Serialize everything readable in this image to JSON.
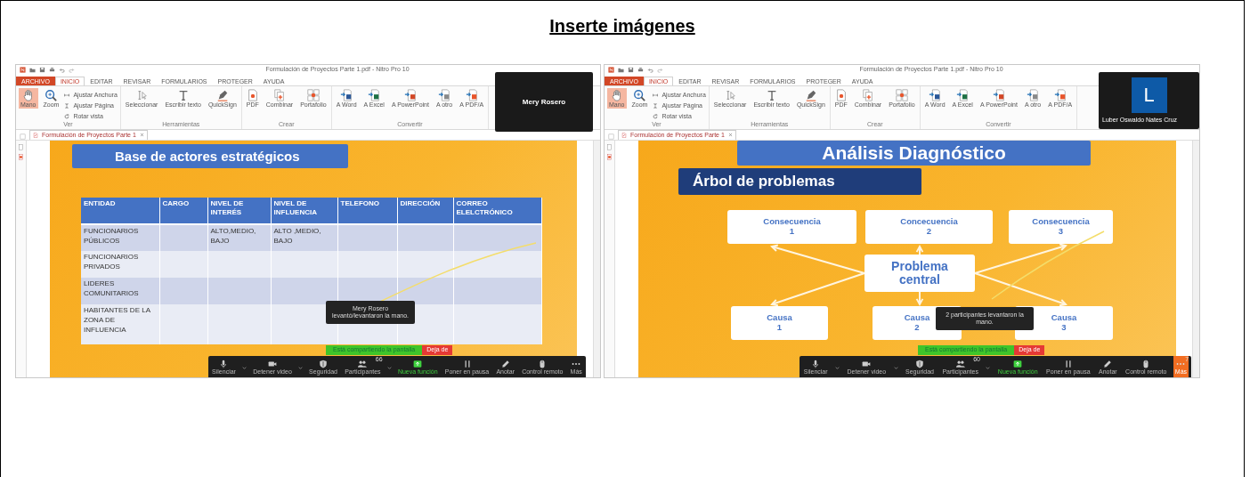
{
  "heading": "Inserte imágenes",
  "screenshots": [
    {
      "window_title": "Formulación de Proyectos Parte 1.pdf - Nitro Pro 10",
      "ribbon_tabs": [
        {
          "label": "ARCHIVO",
          "kind": "file",
          "selected": false
        },
        {
          "label": "INICIO",
          "kind": "tab",
          "selected": true
        },
        {
          "label": "EDITAR",
          "kind": "tab",
          "selected": false
        },
        {
          "label": "REVISAR",
          "kind": "tab",
          "selected": false
        },
        {
          "label": "FORMULARIOS",
          "kind": "tab",
          "selected": false
        },
        {
          "label": "PROTEGER",
          "kind": "tab",
          "selected": false
        },
        {
          "label": "AYUDA",
          "kind": "tab",
          "selected": false
        }
      ],
      "ribbon_groups": [
        {
          "label": "Ver",
          "items": [
            {
              "label": "Mano",
              "kind": "hand",
              "small": false,
              "selected": true
            },
            {
              "label": "Zoom",
              "kind": "zoom",
              "small": false,
              "selected": false
            },
            {
              "label": "Ajustar Anchura",
              "kind": "fitwidth",
              "small": true,
              "selected": false
            },
            {
              "label": "Ajustar Página",
              "kind": "fitpage",
              "small": true,
              "selected": false
            },
            {
              "label": "Rotar vista",
              "kind": "rotate",
              "small": true,
              "selected": false
            }
          ]
        },
        {
          "label": "Herramientas",
          "items": [
            {
              "label": "Seleccionar",
              "kind": "select",
              "small": false,
              "selected": false
            },
            {
              "label": "Escribir texto",
              "kind": "type",
              "small": false,
              "selected": false
            },
            {
              "label": "QuickSign",
              "kind": "sign",
              "small": false,
              "selected": false
            }
          ]
        },
        {
          "label": "Crear",
          "items": [
            {
              "label": "PDF",
              "kind": "pdf",
              "small": false,
              "selected": false
            },
            {
              "label": "Combinar",
              "kind": "combine",
              "small": false,
              "selected": false
            },
            {
              "label": "Portafolio",
              "kind": "portfolio",
              "small": false,
              "selected": false
            }
          ]
        },
        {
          "label": "Convertir",
          "items": [
            {
              "label": "A Word",
              "kind": "word",
              "small": false,
              "selected": false
            },
            {
              "label": "A Excel",
              "kind": "excel",
              "small": false,
              "selected": false
            },
            {
              "label": "A PowerPoint",
              "kind": "ppt",
              "small": false,
              "selected": false
            },
            {
              "label": "A otro",
              "kind": "other",
              "small": false,
              "selected": false
            },
            {
              "label": "A PDF/A",
              "kind": "pdfa",
              "small": false,
              "selected": false
            }
          ]
        }
      ],
      "document_tab": "Formulación de Proyectos Parte 1",
      "video_tile": {
        "name": "Mery Rosero"
      },
      "slide": {
        "kind": "table",
        "title": "Base de actores estratégicos",
        "columns": [
          "ENTIDAD",
          "CARGO",
          "NIVEL DE INTERÉS",
          "NIVEL DE INFLUENCIA",
          "TELEFONO",
          "DIRECCIÓN",
          "CORREO ELELCTRÓNICO"
        ],
        "rows": [
          [
            "FUNCIONARIOS PÚBLICOS",
            null,
            "ALTO,MEDIO, BAJO",
            "ALTO ,MEDIO, BAJO",
            null,
            null,
            null
          ],
          [
            "FUNCIONARIOS PRIVADOS",
            null,
            null,
            null,
            null,
            null,
            null
          ],
          [
            "LIDERES COMUNITARIOS",
            null,
            null,
            null,
            null,
            null,
            null
          ],
          [
            "HABITANTES DE LA ZONA DE INFLUENCIA",
            null,
            null,
            null,
            null,
            null,
            null
          ]
        ]
      },
      "notification": "Mery Rosero levantó/levantaron la mano.",
      "share_bar": {
        "label": "Está compartiendo la pantalla",
        "stop": "Deja de"
      },
      "toolbar": [
        {
          "label": "Silenciar",
          "kind": "mic",
          "has_menu": true,
          "highlighted": false
        },
        {
          "label": "Detener video",
          "kind": "camera",
          "has_menu": true,
          "highlighted": false
        },
        {
          "label": "Seguridad",
          "kind": "shield",
          "has_menu": false,
          "highlighted": false
        },
        {
          "label": "Participantes",
          "kind": "people",
          "badge": "66",
          "has_menu": true,
          "highlighted": false
        },
        {
          "label": "Nueva función",
          "kind": "share",
          "has_menu": false,
          "highlighted": false
        },
        {
          "label": "Poner en pausa",
          "kind": "pause",
          "has_menu": false,
          "highlighted": false
        },
        {
          "label": "Anotar",
          "kind": "pencil",
          "has_menu": false,
          "highlighted": false
        },
        {
          "label": "Control remoto",
          "kind": "mouse",
          "has_menu": false,
          "highlighted": false
        },
        {
          "label": "Más",
          "kind": "dots",
          "has_menu": false,
          "highlighted": false
        }
      ]
    },
    {
      "window_title": "Formulación de Proyectos Parte 1.pdf - Nitro Pro 10",
      "ribbon_tabs": [
        {
          "label": "ARCHIVO",
          "kind": "file",
          "selected": false
        },
        {
          "label": "INICIO",
          "kind": "tab",
          "selected": true
        },
        {
          "label": "EDITAR",
          "kind": "tab",
          "selected": false
        },
        {
          "label": "REVISAR",
          "kind": "tab",
          "selected": false
        },
        {
          "label": "FORMULARIOS",
          "kind": "tab",
          "selected": false
        },
        {
          "label": "PROTEGER",
          "kind": "tab",
          "selected": false
        },
        {
          "label": "AYUDA",
          "kind": "tab",
          "selected": false
        }
      ],
      "ribbon_groups": [
        {
          "label": "Ver",
          "items": [
            {
              "label": "Mano",
              "kind": "hand",
              "small": false,
              "selected": true
            },
            {
              "label": "Zoom",
              "kind": "zoom",
              "small": false,
              "selected": false
            },
            {
              "label": "Ajustar Anchura",
              "kind": "fitwidth",
              "small": true,
              "selected": false
            },
            {
              "label": "Ajustar Página",
              "kind": "fitpage",
              "small": true,
              "selected": false
            },
            {
              "label": "Rotar vista",
              "kind": "rotate",
              "small": true,
              "selected": false
            }
          ]
        },
        {
          "label": "Herramientas",
          "items": [
            {
              "label": "Seleccionar",
              "kind": "select",
              "small": false,
              "selected": false
            },
            {
              "label": "Escribir texto",
              "kind": "type",
              "small": false,
              "selected": false
            },
            {
              "label": "QuickSign",
              "kind": "sign",
              "small": false,
              "selected": false
            }
          ]
        },
        {
          "label": "Crear",
          "items": [
            {
              "label": "PDF",
              "kind": "pdf",
              "small": false,
              "selected": false
            },
            {
              "label": "Combinar",
              "kind": "combine",
              "small": false,
              "selected": false
            },
            {
              "label": "Portafolio",
              "kind": "portfolio",
              "small": false,
              "selected": false
            }
          ]
        },
        {
          "label": "Convertir",
          "items": [
            {
              "label": "A Word",
              "kind": "word",
              "small": false,
              "selected": false
            },
            {
              "label": "A Excel",
              "kind": "excel",
              "small": false,
              "selected": false
            },
            {
              "label": "A PowerPoint",
              "kind": "ppt",
              "small": false,
              "selected": false
            },
            {
              "label": "A otro",
              "kind": "other",
              "small": false,
              "selected": false
            },
            {
              "label": "A PDF/A",
              "kind": "pdfa",
              "small": false,
              "selected": false
            }
          ]
        }
      ],
      "document_tab": "Formulación de Proyectos Parte 1",
      "video_tile": {
        "name": "Luber Oswaldo Nates Cruz",
        "avatar": "L"
      },
      "slide": {
        "kind": "tree",
        "title": "Análisis Diagnóstico",
        "subtitle": "Árbol de problemas",
        "consequences": [
          {
            "title": "Consecuencia",
            "number": "1"
          },
          {
            "title": "Concecuencia",
            "number": "2"
          },
          {
            "title": "Consecuencia",
            "number": "3"
          }
        ],
        "center": "Problema central",
        "causes": [
          {
            "title": "Causa",
            "number": "1"
          },
          {
            "title": "Causa",
            "number": "2"
          },
          {
            "title": "Causa",
            "number": "3"
          }
        ]
      },
      "notification": "2 participantes levantaron la mano.",
      "share_bar": {
        "label": "Está compartiendo la pantalla",
        "stop": "Deja de"
      },
      "toolbar": [
        {
          "label": "Silenciar",
          "kind": "mic",
          "has_menu": true,
          "highlighted": false
        },
        {
          "label": "Detener video",
          "kind": "camera",
          "has_menu": true,
          "highlighted": false
        },
        {
          "label": "Seguridad",
          "kind": "shield",
          "has_menu": false,
          "highlighted": false
        },
        {
          "label": "Participantes",
          "kind": "people",
          "badge": "60",
          "has_menu": true,
          "highlighted": false
        },
        {
          "label": "Nueva función",
          "kind": "share",
          "has_menu": false,
          "highlighted": false
        },
        {
          "label": "Poner en pausa",
          "kind": "pause",
          "has_menu": false,
          "highlighted": false
        },
        {
          "label": "Anotar",
          "kind": "pencil",
          "has_menu": false,
          "highlighted": false
        },
        {
          "label": "Control remoto",
          "kind": "mouse",
          "has_menu": false,
          "highlighted": false
        },
        {
          "label": "Más",
          "kind": "dots",
          "badge": "7",
          "has_menu": false,
          "highlighted": true
        }
      ]
    }
  ]
}
